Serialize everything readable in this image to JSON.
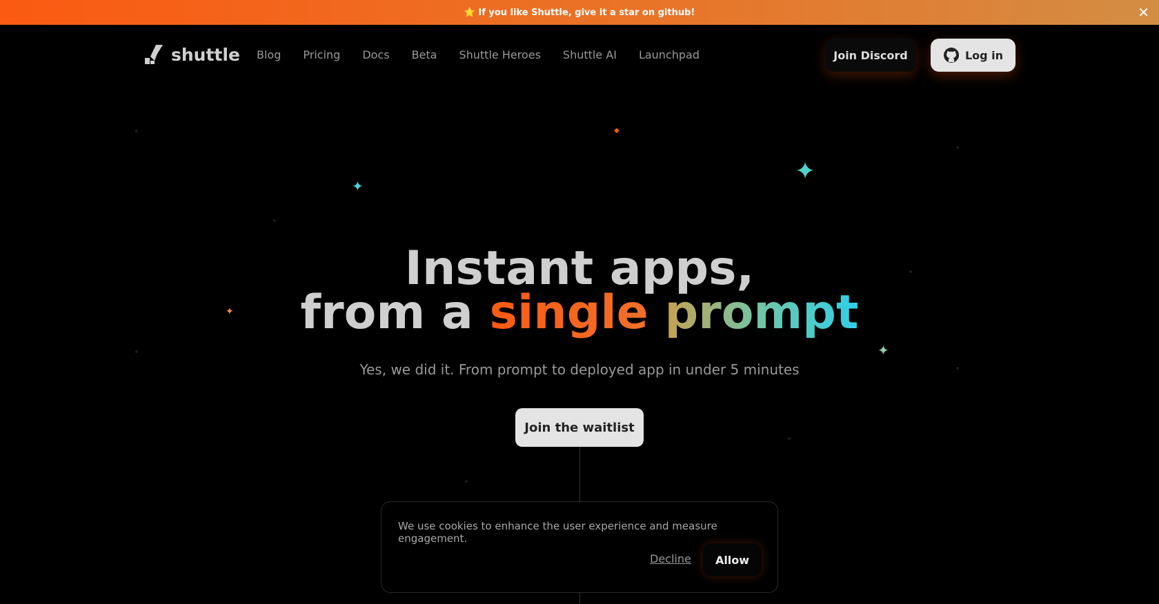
{
  "banner": {
    "text": "⭐ If you like Shuttle, give it a star on github!",
    "close_icon": "close-icon"
  },
  "nav": {
    "brand": "shuttle",
    "links": [
      "Blog",
      "Pricing",
      "Docs",
      "Beta",
      "Shuttle Heroes",
      "Shuttle AI",
      "Launchpad"
    ],
    "discord": "Join Discord",
    "login": "Log in"
  },
  "hero": {
    "line1": "Instant apps,",
    "line2_a": "from a",
    "line2_b": "single",
    "line2_c": "prompt",
    "subtitle": "Yes, we did it. From prompt to deployed app in under 5 minutes",
    "cta": "Join the waitlist"
  },
  "cookie": {
    "text": "We use cookies to enhance the user experience and measure engagement.",
    "decline": "Decline",
    "allow": "Allow"
  },
  "colors": {
    "accent_orange": "#fb5a12",
    "accent_cyan": "#2fd0e8"
  }
}
